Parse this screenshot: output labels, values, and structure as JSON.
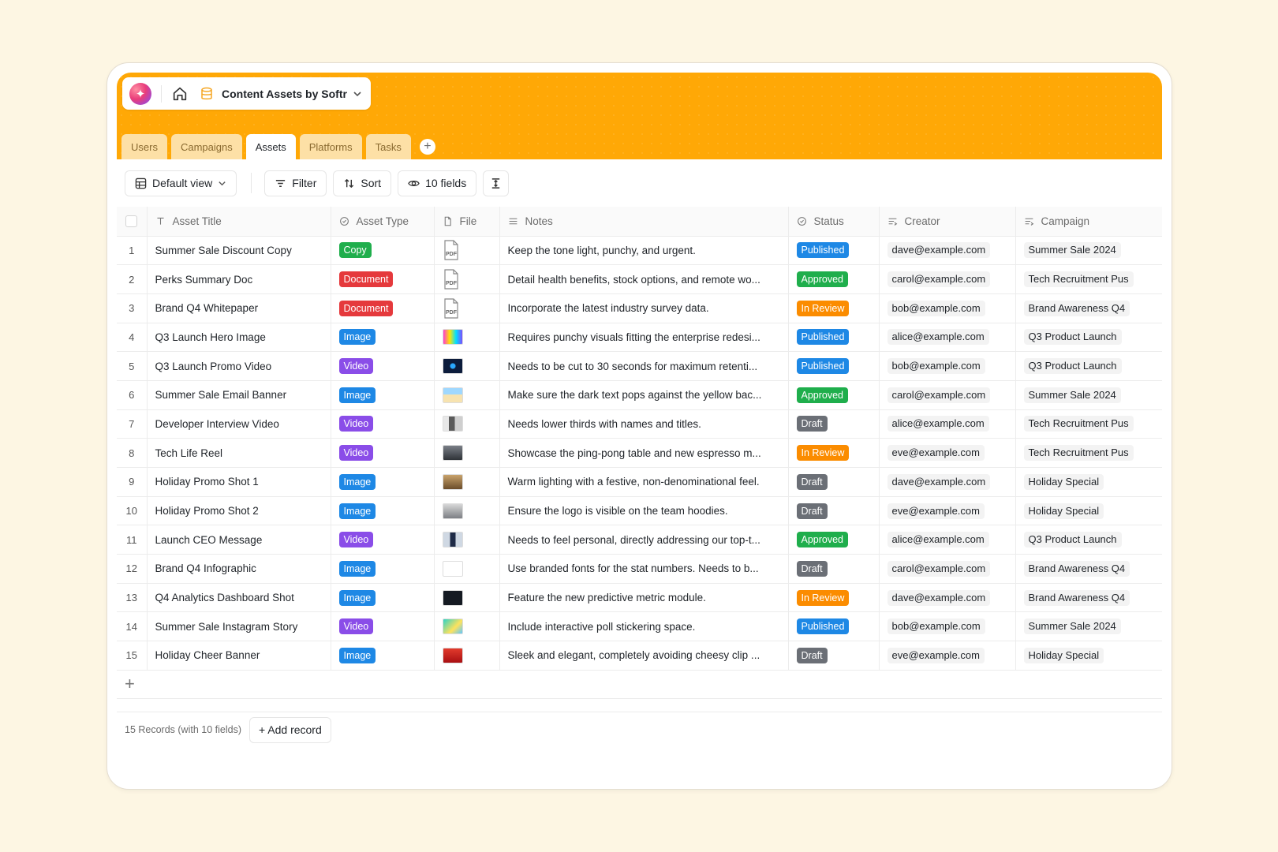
{
  "app": {
    "title": "Content Assets by Softr"
  },
  "tabs": [
    {
      "label": "Users",
      "active": false
    },
    {
      "label": "Campaigns",
      "active": false
    },
    {
      "label": "Assets",
      "active": true
    },
    {
      "label": "Platforms",
      "active": false
    },
    {
      "label": "Tasks",
      "active": false
    }
  ],
  "toolbar": {
    "view_label": "Default view",
    "filter_label": "Filter",
    "sort_label": "Sort",
    "fields_label": "10 fields"
  },
  "columns": [
    {
      "label": "Asset Title",
      "icon": "text-icon"
    },
    {
      "label": "Asset Type",
      "icon": "select-icon"
    },
    {
      "label": "File",
      "icon": "file-icon"
    },
    {
      "label": "Notes",
      "icon": "lines-icon"
    },
    {
      "label": "Status",
      "icon": "select-icon"
    },
    {
      "label": "Creator",
      "icon": "linked-icon"
    },
    {
      "label": "Campaign",
      "icon": "linked-icon"
    }
  ],
  "colors": {
    "Copy": "#1fae4c",
    "Document": "#e5393c",
    "Image": "#1e88e5",
    "Video": "#8a4de8",
    "Published": "#1e88e5",
    "Approved": "#1fae4c",
    "In Review": "#fb8c00",
    "Draft": "#6b6f76"
  },
  "rows": [
    {
      "num": "1",
      "title": "Summer Sale Discount Copy",
      "type": "Copy",
      "file": "pdf",
      "notes": "Keep the tone light, punchy, and urgent.",
      "status": "Published",
      "creator": "dave@example.com",
      "campaign": "Summer Sale 2024"
    },
    {
      "num": "2",
      "title": "Perks Summary Doc",
      "type": "Document",
      "file": "pdf",
      "notes": "Detail health benefits, stock options, and remote wo...",
      "status": "Approved",
      "creator": "carol@example.com",
      "campaign": "Tech Recruitment Pus"
    },
    {
      "num": "3",
      "title": "Brand Q4 Whitepaper",
      "type": "Document",
      "file": "pdf",
      "notes": "Incorporate the latest industry survey data.",
      "status": "In Review",
      "creator": "bob@example.com",
      "campaign": "Brand Awareness Q4"
    },
    {
      "num": "4",
      "title": "Q3 Launch Hero Image",
      "type": "Image",
      "file": "colorful",
      "notes": "Requires punchy visuals fitting the enterprise redesi...",
      "status": "Published",
      "creator": "alice@example.com",
      "campaign": "Q3 Product Launch"
    },
    {
      "num": "5",
      "title": "Q3 Launch Promo Video",
      "type": "Video",
      "file": "dark-blue",
      "notes": "Needs to be cut to 30 seconds for maximum retenti...",
      "status": "Published",
      "creator": "bob@example.com",
      "campaign": "Q3 Product Launch"
    },
    {
      "num": "6",
      "title": "Summer Sale Email Banner",
      "type": "Image",
      "file": "beach",
      "notes": "Make sure the dark text pops against the yellow bac...",
      "status": "Approved",
      "creator": "carol@example.com",
      "campaign": "Summer Sale 2024"
    },
    {
      "num": "7",
      "title": "Developer Interview Video",
      "type": "Video",
      "file": "person",
      "notes": "Needs lower thirds with names and titles.",
      "status": "Draft",
      "creator": "alice@example.com",
      "campaign": "Tech Recruitment Pus"
    },
    {
      "num": "8",
      "title": "Tech Life Reel",
      "type": "Video",
      "file": "office",
      "notes": "Showcase the ping-pong table and new espresso m...",
      "status": "In Review",
      "creator": "eve@example.com",
      "campaign": "Tech Recruitment Pus"
    },
    {
      "num": "9",
      "title": "Holiday Promo Shot 1",
      "type": "Image",
      "file": "warm",
      "notes": "Warm lighting with a festive, non-denominational feel.",
      "status": "Draft",
      "creator": "dave@example.com",
      "campaign": "Holiday Special"
    },
    {
      "num": "10",
      "title": "Holiday Promo Shot 2",
      "type": "Image",
      "file": "team",
      "notes": "Ensure the logo is visible on the team hoodies.",
      "status": "Draft",
      "creator": "eve@example.com",
      "campaign": "Holiday Special"
    },
    {
      "num": "11",
      "title": "Launch CEO Message",
      "type": "Video",
      "file": "ceo",
      "notes": "Needs to feel personal, directly addressing our top-t...",
      "status": "Approved",
      "creator": "alice@example.com",
      "campaign": "Q3 Product Launch"
    },
    {
      "num": "12",
      "title": "Brand Q4 Infographic",
      "type": "Image",
      "file": "infographic",
      "notes": "Use branded fonts for the stat numbers. Needs to b...",
      "status": "Draft",
      "creator": "carol@example.com",
      "campaign": "Brand Awareness Q4"
    },
    {
      "num": "13",
      "title": "Q4 Analytics Dashboard Shot",
      "type": "Image",
      "file": "dark",
      "notes": "Feature the new predictive metric module.",
      "status": "In Review",
      "creator": "dave@example.com",
      "campaign": "Brand Awareness Q4"
    },
    {
      "num": "14",
      "title": "Summer Sale Instagram Story",
      "type": "Video",
      "file": "story",
      "notes": "Include interactive poll stickering space.",
      "status": "Published",
      "creator": "bob@example.com",
      "campaign": "Summer Sale 2024"
    },
    {
      "num": "15",
      "title": "Holiday Cheer Banner",
      "type": "Image",
      "file": "red",
      "notes": "Sleek and elegant, completely avoiding cheesy clip ...",
      "status": "Draft",
      "creator": "eve@example.com",
      "campaign": "Holiday Special"
    }
  ],
  "footer": {
    "count_label": "15 Records (with 10 fields)",
    "add_record_label": "+ Add record"
  }
}
